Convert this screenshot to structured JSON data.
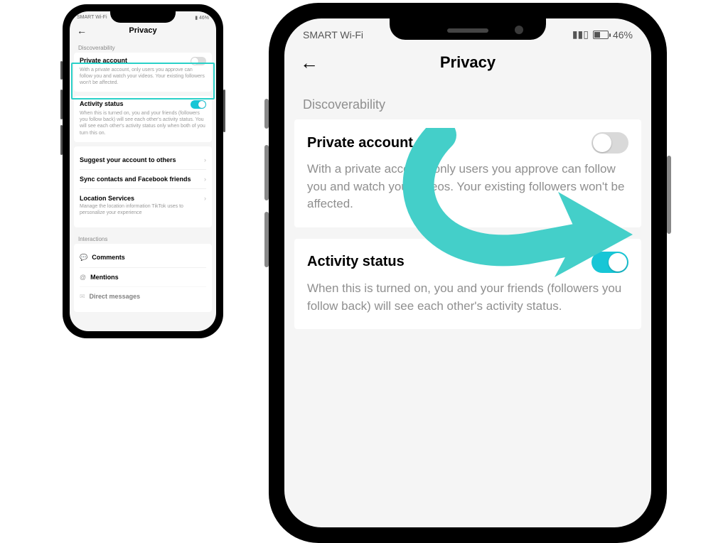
{
  "status_bar": {
    "carrier": "SMART Wi-Fi",
    "battery_pct": "46%"
  },
  "header": {
    "title": "Privacy"
  },
  "sections": {
    "discoverability": "Discoverability",
    "interactions": "Interactions"
  },
  "private_account": {
    "title": "Private account",
    "on": false,
    "desc_full": "With a private account, only users you approve can follow you and watch your videos. Your existing followers won't be affected.",
    "desc_large": "With a private account, only users you approve can follow you and watch your videos. Your existing followers won't be affected."
  },
  "activity_status": {
    "title": "Activity status",
    "on": true,
    "desc_full": "When this is turned on, you and your friends (followers you follow back) will see each other's activity status. You will see each other's activity status only when both of you turn this on.",
    "desc_large": "When this is turned on, you and your friends (followers you follow back) will see each other's activity status."
  },
  "nav_items": {
    "suggest": "Suggest your account to others",
    "sync": "Sync contacts and Facebook friends",
    "location": {
      "title": "Location Services",
      "desc": "Manage the location information TikTok uses to personalize your experience"
    }
  },
  "interactions": {
    "comments": "Comments",
    "mentions": "Mentions",
    "direct": "Direct messages"
  },
  "colors": {
    "accent": "#17c6d6",
    "highlight": "#2ad1c9"
  }
}
